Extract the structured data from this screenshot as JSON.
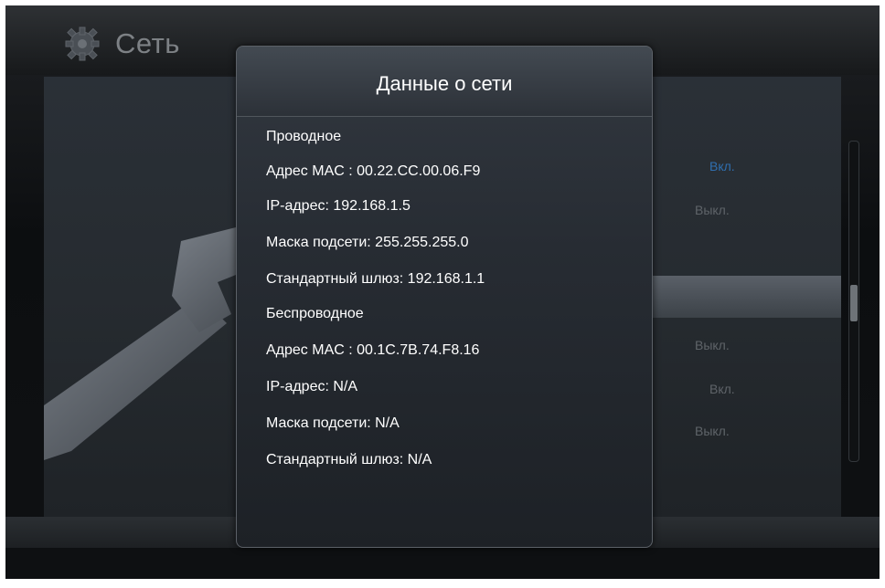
{
  "header": {
    "title": "Сеть",
    "icon": "gear-icon"
  },
  "background_options": [
    "Вкл.",
    "Выкл.",
    "Выкл.",
    "Вкл.",
    "Выкл."
  ],
  "dialog": {
    "title": "Данные о сети",
    "lines": [
      "Проводное",
      "Адрес MAC : 00.22.CC.00.06.F9",
      "IP-адрес: 192.168.1.5",
      "Маска подсети: 255.255.255.0",
      "Стандартный шлюз: 192.168.1.1",
      "Беспроводное",
      "Адрес MAC : 00.1C.7B.74.F8.16",
      "IP-адрес: N/A",
      "Маска подсети: N/A",
      "Стандартный шлюз: N/A"
    ]
  },
  "colors": {
    "accent_blue": "#2f6fb0",
    "dialog_bg": "#2a3037",
    "text": "#ffffff"
  }
}
